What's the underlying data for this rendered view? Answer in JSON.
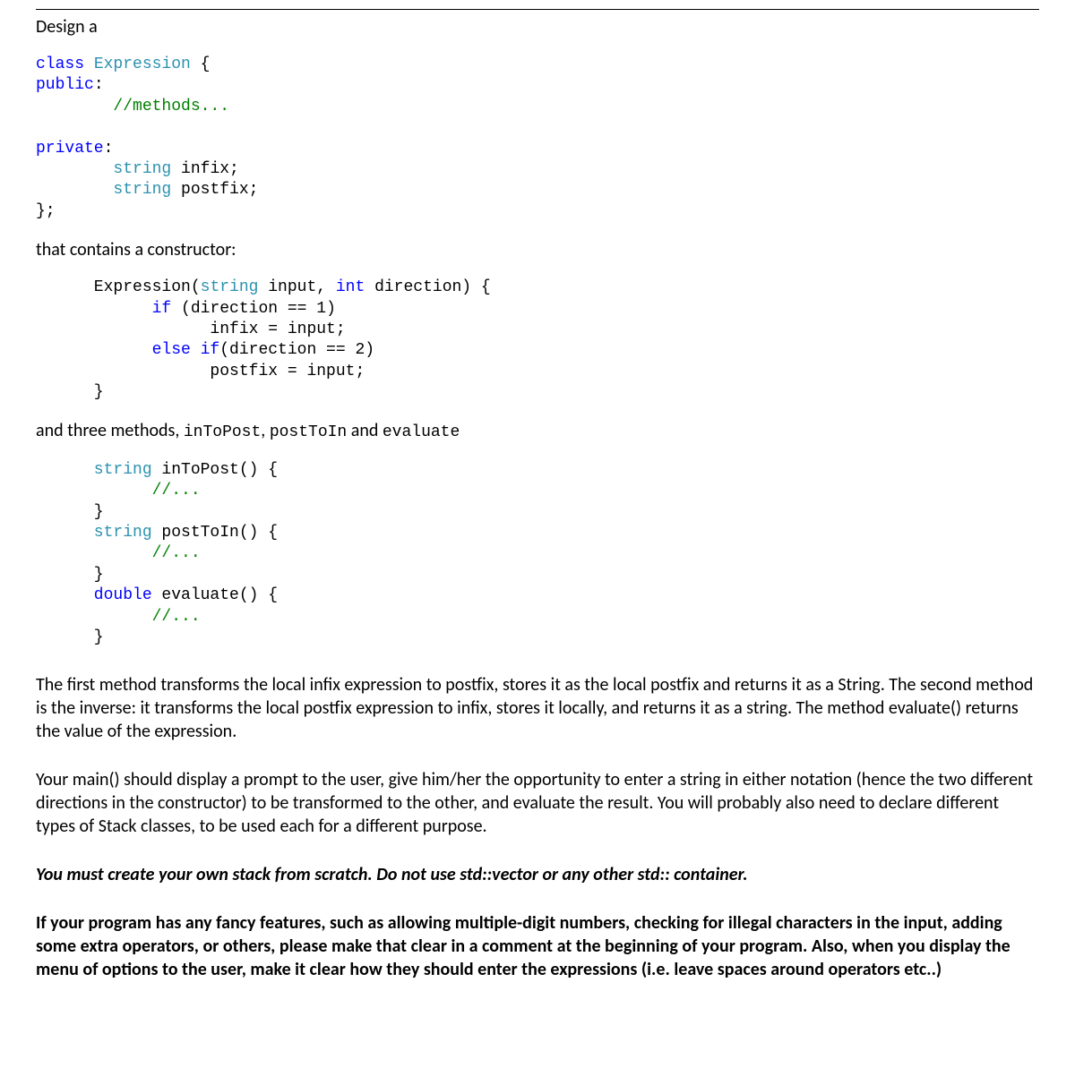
{
  "intro": "Design a",
  "code1": {
    "line1a": "class",
    "line1b": "Expression",
    "line1c": "{",
    "line2a": "public",
    "line2b": ":",
    "line3": "        //methods...",
    "line5a": "private",
    "line5b": ":",
    "line6a": "        string",
    "line6b": " infix;",
    "line7a": "        string",
    "line7b": " postfix;",
    "line8": "};"
  },
  "text1": "that contains a constructor:",
  "code2": {
    "l1a": "      Expression(",
    "l1b": "string",
    "l1c": " input, ",
    "l1d": "int",
    "l1e": " direction) {",
    "l2a": "            if",
    "l2b": " (direction == 1)",
    "l3": "                  infix = input;",
    "l4a": "            else if",
    "l4b": "(direction == 2)",
    "l5": "                  postfix = input;",
    "l6": "      }"
  },
  "text2a": "and three methods, ",
  "text2b": "inToPost",
  "text2c": ", ",
  "text2d": "postToIn",
  "text2e": " and ",
  "text2f": "evaluate",
  "code3": {
    "l1a": "      string",
    "l1b": " inToPost() {",
    "l2": "            //...",
    "l3": "      }",
    "l4a": "      string",
    "l4b": " postToIn() {",
    "l5": "            //...",
    "l6": "      }",
    "l7a": "      double",
    "l7b": " evaluate() {",
    "l8": "            //...",
    "l9": "      }"
  },
  "para1": "The first method transforms the local infix expression to postfix, stores it as the local postfix and returns it as a String. The second method is the inverse: it transforms the local postfix expression to infix, stores it locally, and returns it as a string. The method evaluate() returns the value of the expression.",
  "para2": "Your main() should display a prompt to the user, give him/her the opportunity to enter a string in either notation (hence the two different directions in the constructor) to be  transformed to the other, and evaluate the result. You will probably also need to declare different types of Stack classes, to be used each for a different purpose.",
  "para3": "You must create your own stack from scratch. Do not use std::vector or any other std:: container.",
  "para4": "If your program has any fancy features, such as allowing multiple-digit numbers, checking for illegal characters in the input, adding some extra operators, or others, please make that clear in a comment at the beginning of your program. Also, when you display the menu of options to the user, make it clear how they should enter the expressions (i.e. leave spaces around operators etc..)"
}
